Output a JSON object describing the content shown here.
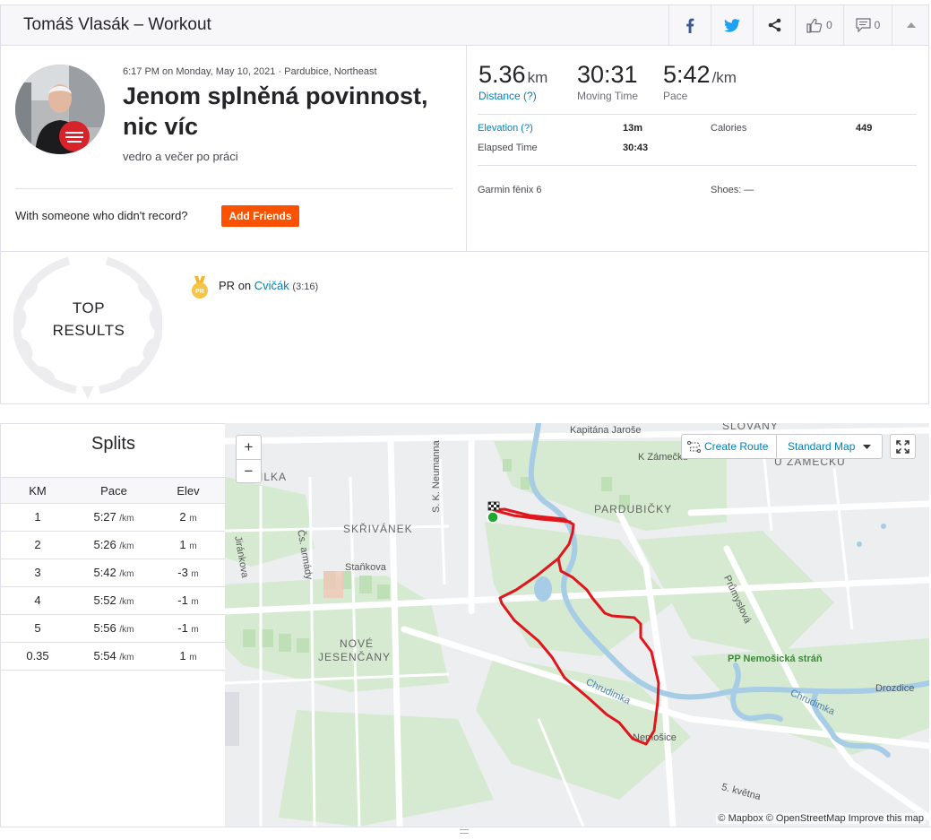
{
  "header": {
    "title": "Tomáš Vlasák – Workout",
    "kudos_count": "0",
    "comments_count": "0",
    "icons": [
      "facebook-icon",
      "twitter-icon",
      "share-icon",
      "thumbs-up-icon",
      "comment-icon",
      "caret-up-icon"
    ]
  },
  "activity": {
    "meta": "6:17 PM on Monday, May 10, 2021 · Pardubice, Northeast",
    "name": "Jenom splněná povinnost, nic víc",
    "description": "vedro a večer po práci",
    "with_someone": "With someone who didn't record?",
    "add_friends": "Add Friends"
  },
  "stats": {
    "distance": {
      "value": "5.36",
      "unit": "km",
      "label": "Distance (?)"
    },
    "moving_time": {
      "value": "30:31",
      "label": "Moving Time"
    },
    "pace": {
      "value": "5:42",
      "unit": "/km",
      "label": "Pace"
    },
    "elevation_label": "Elevation (?)",
    "elevation_value": "13m",
    "calories_label": "Calories",
    "calories_value": "449",
    "elapsed_label": "Elapsed Time",
    "elapsed_value": "30:43",
    "device": "Garmin fēnix 6",
    "shoes": "Shoes: —"
  },
  "top_results": {
    "title_line1": "TOP",
    "title_line2": "RESULTS",
    "pr_badge": "PR",
    "pr_label": "PR",
    "pr_on": "on",
    "segment": "Cvičák",
    "segment_time": "(3:16)"
  },
  "splits": {
    "title": "Splits",
    "headers": [
      "KM",
      "Pace",
      "Elev"
    ],
    "pace_unit": "/km",
    "elev_unit": "m",
    "rows": [
      {
        "km": "1",
        "pace": "5:27",
        "elev": "2"
      },
      {
        "km": "2",
        "pace": "5:26",
        "elev": "1"
      },
      {
        "km": "3",
        "pace": "5:42",
        "elev": "-3"
      },
      {
        "km": "4",
        "pace": "5:52",
        "elev": "-1"
      },
      {
        "km": "5",
        "pace": "5:56",
        "elev": "-1"
      },
      {
        "km": "0.35",
        "pace": "5:54",
        "elev": "1"
      }
    ]
  },
  "map": {
    "zoom_in": "+",
    "zoom_out": "−",
    "create_route": "Create Route",
    "map_style": "Standard Map",
    "attribution": "© Mapbox © OpenStreetMap Improve this map",
    "route_color": "#e0161c",
    "labels": {
      "kapitana": "Kapitána Jaroše",
      "slovany": "SLOVANY",
      "k_zamecku": "K Zámečku",
      "u_zamecku": "U ZÁMEČKU",
      "pardubicky": "PARDUBIČKY",
      "zadilka": "ZADILKA",
      "skrivanek": "SKŘIVÁNEK",
      "sk_neumanna": "S. K. Neumanna",
      "cs_armady": "Čs. armády",
      "jiraskova": "Jiránkova",
      "stankova": "Staňkova",
      "prumyslova": "Průmyslová",
      "nemosicka": "PP Nemošická stráň",
      "drozdice": "Drozdice",
      "chrudimka1": "Chrudimka",
      "chrudimka2": "Chrudimka",
      "nove_jesencany1": "NOVÉ",
      "nove_jesencany2": "JESENČANY",
      "nemosice": "Nemošice",
      "kvetna": "5. května"
    }
  },
  "colors": {
    "accent": "#fc5200",
    "link": "#007fb6",
    "route": "#e0161c",
    "start": "#1ea82f"
  }
}
